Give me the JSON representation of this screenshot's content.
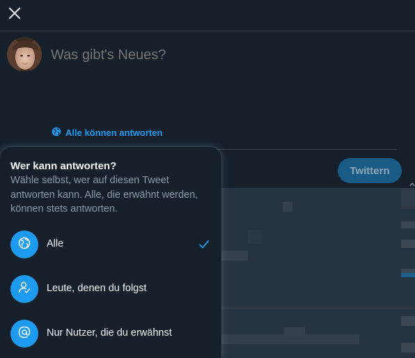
{
  "composer": {
    "placeholder": "Was gibt's Neues?",
    "reply_setting_label": "Alle können antworten",
    "tweet_button_label": "Twittern"
  },
  "reply_popup": {
    "title": "Wer kann antworten?",
    "description": "Wähle selbst, wer auf diesen Tweet antworten kann. Alle, die erwähnt werden, können stets antworten.",
    "options": [
      {
        "label": "Alle",
        "icon": "globe-icon",
        "selected": true
      },
      {
        "label": "Leute, denen du folgst",
        "icon": "person-check-icon",
        "selected": false
      },
      {
        "label": "Nur Nutzer, die du erwähnst",
        "icon": "at-icon",
        "selected": false
      }
    ]
  },
  "icons": {
    "close": "close-icon",
    "avatar": "avatar",
    "reply_setting": "globe-icon",
    "selected_check": "checkmark-icon"
  },
  "colors": {
    "background": "#15202b",
    "accent": "#1d9bf0",
    "text_primary": "#f7f9f9",
    "text_secondary": "#8b98a5",
    "divider": "#38444d",
    "tweet_button_disabled": "#1a5b86"
  }
}
